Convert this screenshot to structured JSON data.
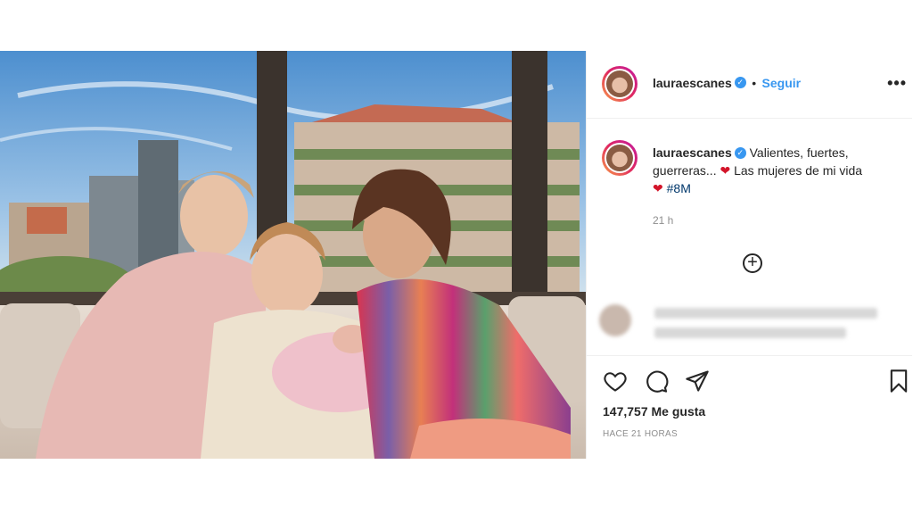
{
  "post": {
    "username": "lauraescanes",
    "follow_label": "Seguir",
    "more_label": "•••",
    "verified_mark": "✓",
    "caption_line1": "Valientes, fuertes,",
    "caption_line2_prefix": "guerreras...",
    "caption_line2_suffix": "Las mujeres de mi vida",
    "hashtag": "#8M",
    "heart_emoji": "❤",
    "time_short": "21 h",
    "add_comment_glyph": "+",
    "likes": "147,757 Me gusta",
    "time_ago": "HACE 21 HORAS"
  },
  "icons": [
    "heart-icon",
    "comment-icon",
    "share-icon",
    "bookmark-icon",
    "plus-circle-icon",
    "verified-badge-icon",
    "more-options-icon"
  ],
  "colors": {
    "accent": "#3897f0",
    "hashtag": "#00376b",
    "text": "#262626",
    "muted": "#8e8e8e",
    "border": "#efefef"
  }
}
